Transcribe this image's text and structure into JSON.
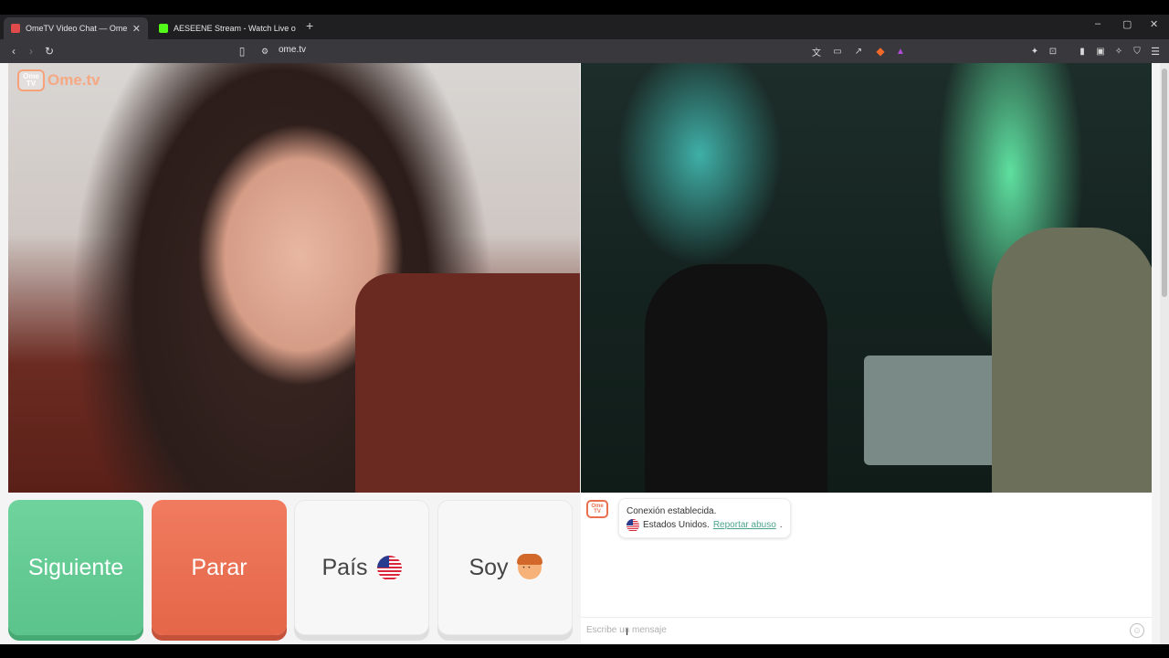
{
  "browser": {
    "tabs": [
      {
        "title": "OmeTV Video Chat — Omeg",
        "favicon_color": "#e04a4a"
      },
      {
        "title": "AESEENE Stream - Watch Live on Kick",
        "favicon_color": "#53fc18"
      }
    ],
    "close_tab": "✕",
    "new_tab": "+",
    "url": "ome.tv",
    "window_controls": {
      "minimize": "–",
      "maximize": "▢",
      "close": "✕"
    }
  },
  "logo": {
    "icon_text": "Ome TV",
    "brand": "Ome.tv"
  },
  "buttons": {
    "next": "Siguiente",
    "stop": "Parar",
    "country": "País",
    "gender": "Soy"
  },
  "chat": {
    "avatar_text": "Ome TV",
    "status": "Conexión establecida.",
    "country": "Estados Unidos.",
    "report_link": "Reportar abuso",
    "report_suffix": ".",
    "input_placeholder": "Escribe un mensaje"
  },
  "colors": {
    "next": "#5bc38c",
    "stop": "#e56649",
    "link": "#4ca38c"
  }
}
